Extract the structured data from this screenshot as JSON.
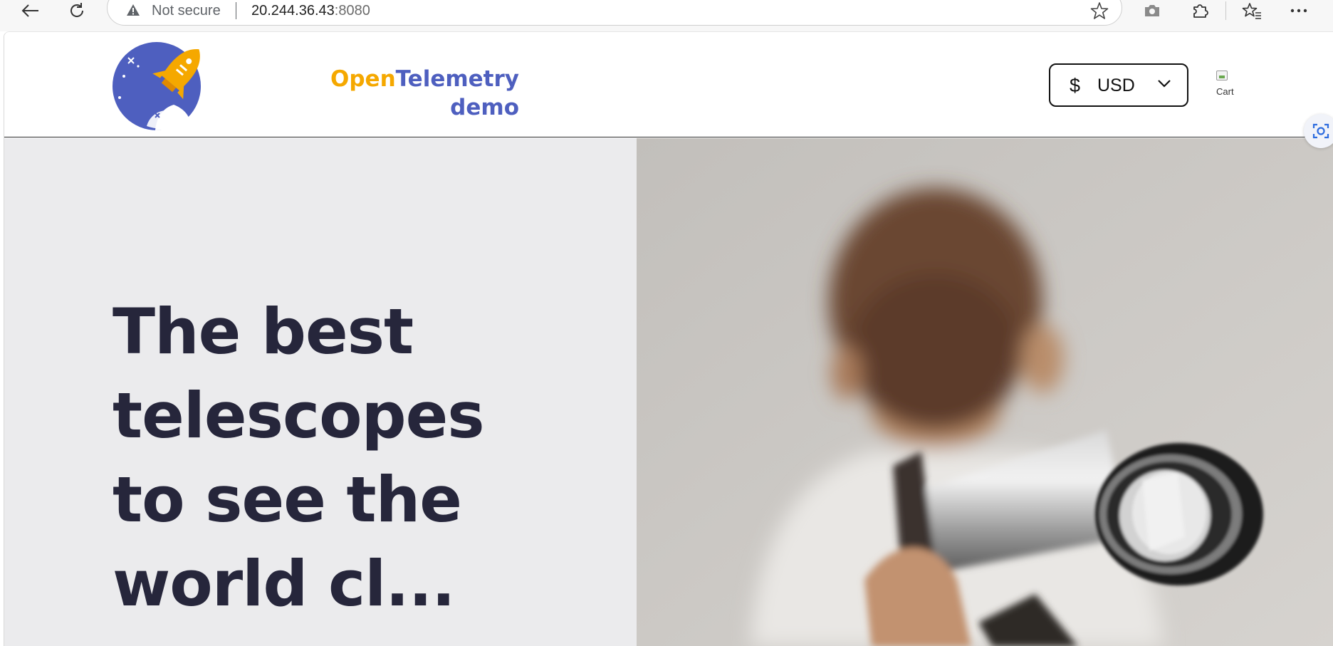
{
  "browser": {
    "security_label": "Not secure",
    "url_host": "20.244.36.43",
    "url_port": ":8080"
  },
  "header": {
    "logo": {
      "word_open": "Open",
      "word_telemetry": "Telemetry",
      "word_demo": "demo"
    },
    "currency": {
      "symbol": "$",
      "selected": "USD"
    },
    "cart": {
      "alt_text": "Cart"
    }
  },
  "hero": {
    "title": "The best telescopes to see the world cl..."
  },
  "colors": {
    "brand_orange": "#f5a800",
    "brand_blue": "#4e5fbf",
    "hero_text": "#26263b",
    "hero_bg": "#ebebed"
  },
  "icons": {
    "back": "back-arrow-icon",
    "reload": "reload-icon",
    "warning": "warning-icon",
    "favorite": "star-icon",
    "screenshot": "camera-icon",
    "extensions": "puzzle-icon",
    "favorites": "favorites-icon",
    "more": "more-icon",
    "dropdown": "chevron-down-icon",
    "visual_search": "visual-search-icon"
  }
}
